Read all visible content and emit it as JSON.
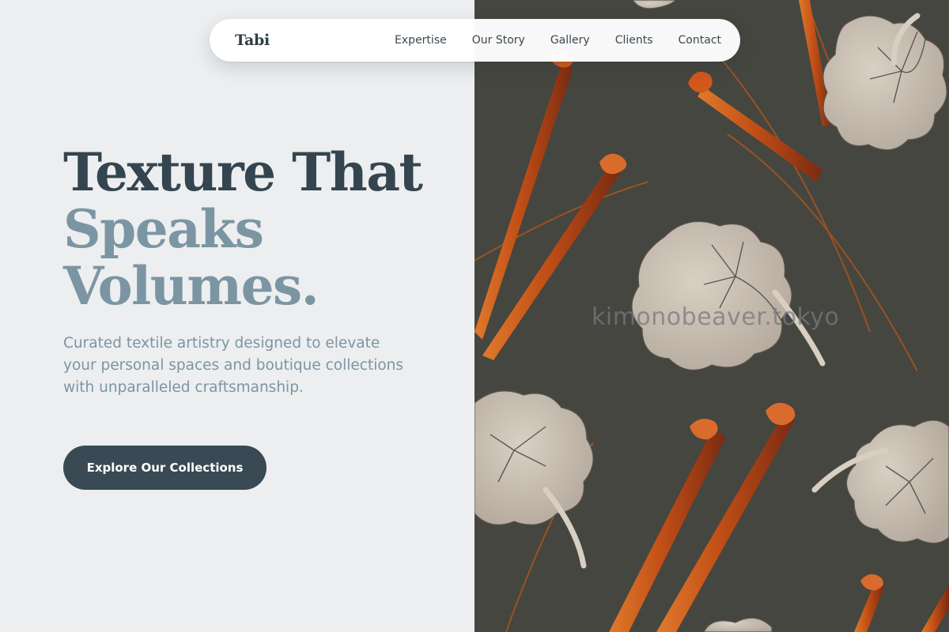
{
  "nav": {
    "brand": "Tabi",
    "links": [
      "Expertise",
      "Our Story",
      "Gallery",
      "Clients",
      "Contact"
    ]
  },
  "hero": {
    "title_line1": "Texture That",
    "title_line2": "Speaks",
    "title_line3": "Volumes.",
    "subtitle": "Curated textile artistry designed to elevate your personal spaces and boutique collections with unparalleled craftsmanship.",
    "cta_label": "Explore Our Collections"
  },
  "image": {
    "watermark": "kimonobeaver.tokyo",
    "subject": "kimono-fabric-pattern"
  },
  "colors": {
    "page_bg": "#eceef0",
    "title_dark": "#34454f",
    "title_light": "#7b95a3",
    "cta_bg": "#394a54",
    "fabric_bg": "#45463f",
    "petal": "#c8bdb0",
    "stem_orange": "#c8561b"
  }
}
